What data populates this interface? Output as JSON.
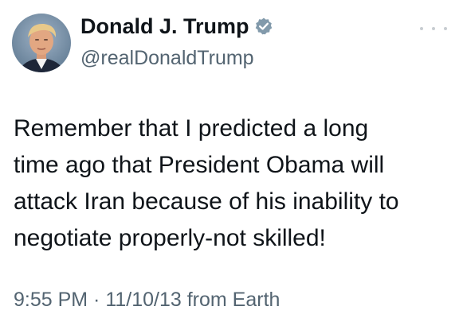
{
  "tweet": {
    "author": {
      "display_name": "Donald J. Trump",
      "handle": "@realDonaldTrump",
      "verified": true,
      "badge_color": "#829aab",
      "avatar_icon": "profile-photo"
    },
    "more_icon": "more-options-icon",
    "body_lines": [
      "Remember that I predicted a long",
      "time ago that President Obama will",
      "attack Iran because of his inability to",
      "negotiate properly-not skilled!"
    ],
    "meta": "9:55 PM · 11/10/13 from Earth"
  },
  "colors": {
    "text": "#0f1419",
    "secondary_text": "#536471",
    "background": "#ffffff"
  }
}
